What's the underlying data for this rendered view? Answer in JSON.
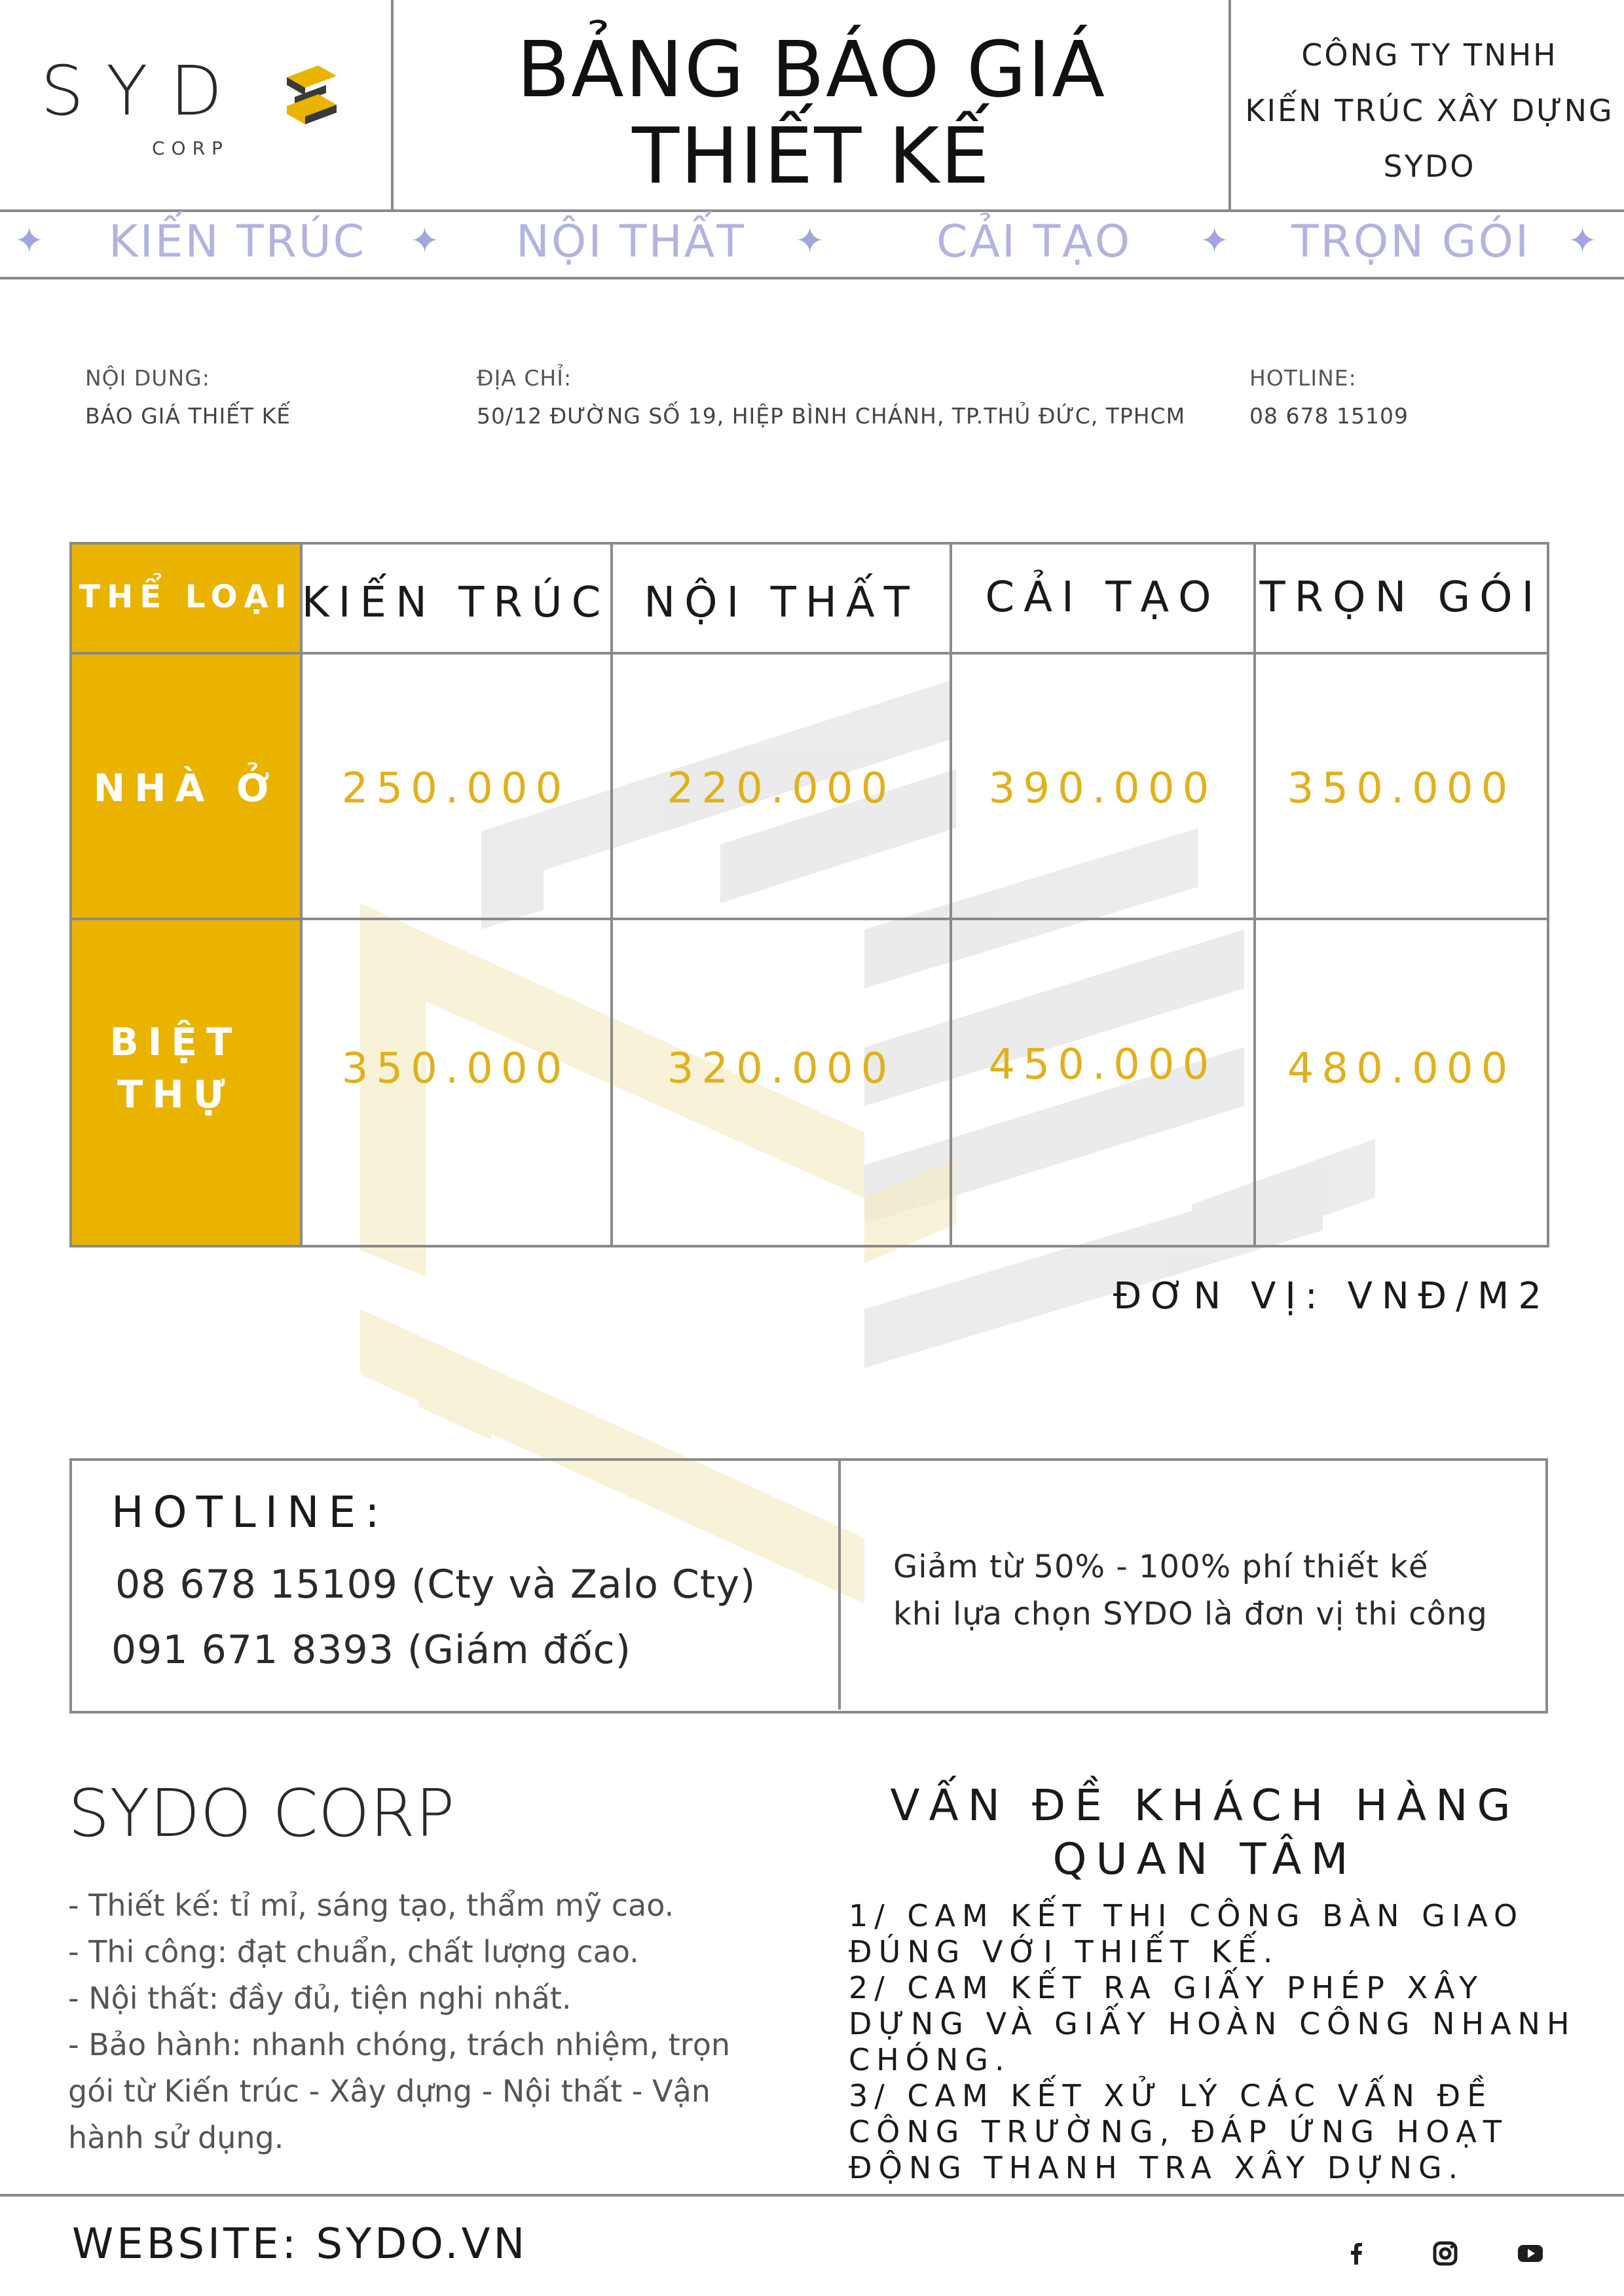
{
  "header": {
    "logo_text": "SYD",
    "logo_sub": "CORP",
    "title_line1": "BẢNG BÁO GIÁ",
    "title_line2": "THIẾT KẾ",
    "company_line1": "CÔNG TY TNHH",
    "company_line2": "KIẾN TRÚC XÂY DỰNG",
    "company_line3": "SYDO"
  },
  "band": {
    "items": [
      "KIẾN TRÚC",
      "NỘI THẤT",
      "CẢI TẠO",
      "TRỌN GÓI"
    ],
    "star_glyph": "✦"
  },
  "info": {
    "content_label": "NỘI DUNG:",
    "content_value": "BÁO GIÁ THIẾT KẾ",
    "address_label": "ĐỊA CHỈ:",
    "address_value": "50/12 ĐƯỜNG SỐ 19, HIỆP BÌNH CHÁNH, TP.THỦ ĐỨC, TPHCM",
    "hotline_label": "HOTLINE:",
    "hotline_value": "08 678 15109"
  },
  "table": {
    "corner": "THỂ LOẠI",
    "columns": [
      "KIẾN TRÚC",
      "NỘI THẤT",
      "CẢI TẠO",
      "TRỌN GÓI"
    ],
    "rows": [
      {
        "label_line1": "NHÀ Ở",
        "label_line2": "",
        "values": [
          "250.000",
          "220.000",
          "390.000",
          "350.000"
        ]
      },
      {
        "label_line1": "BIỆT",
        "label_line2": "THỰ",
        "values": [
          "350.000",
          "320.000",
          "450.000",
          "480.000"
        ]
      }
    ],
    "unit": "ĐƠN VỊ: VNĐ/M2"
  },
  "hotline_box": {
    "title": "HOTLINE:",
    "line1": "08 678 15109 (Cty và Zalo Cty)",
    "line2": "091 671 8393 (Giám đốc)",
    "promo_line1": "Giảm từ 50% - 100% phí thiết kế",
    "promo_line2": "khi lựa chọn SYDO là đơn vị thi công"
  },
  "corp": {
    "title": "SYDO CORP",
    "items": [
      "- Thiết kế: tỉ mỉ, sáng tạo, thẩm mỹ cao.",
      "- Thi công: đạt chuẩn, chất lượng cao.",
      "- Nội thất: đầy đủ, tiện nghi nhất.",
      "- Bảo hành: nhanh chóng, trách nhiệm, trọn",
      "gói từ Kiến trúc - Xây dựng - Nội thất - Vận",
      "hành sử dụng."
    ]
  },
  "concerns": {
    "title_line1": "VẤN ĐỀ KHÁCH HÀNG",
    "title_line2": "QUAN TÂM",
    "lines": [
      "1/ CAM KẾT THI CÔNG BÀN GIAO",
      "ĐÚNG VỚI THIẾT KẾ.",
      "2/ CAM KẾT RA GIẤY PHÉP XÂY",
      "DỰNG VÀ GIẤY HOÀN CÔNG NHANH",
      "CHÓNG.",
      "3/ CAM KẾT XỬ LÝ CÁC VẤN ĐỀ",
      "CÔNG TRƯỜNG, ĐÁP ỨNG HOẠT",
      "ĐỘNG THANH TRA XÂY DỰNG."
    ]
  },
  "footer": {
    "website": "WEBSITE: SYDO.VN",
    "social_icons": [
      "facebook-icon",
      "instagram-icon",
      "youtube-icon"
    ]
  },
  "colors": {
    "accent_yellow": "#e9b300",
    "price_gold": "#e0b11d",
    "band_lavender": "#b2b3e0",
    "rule_gray": "#8a8a8a"
  }
}
